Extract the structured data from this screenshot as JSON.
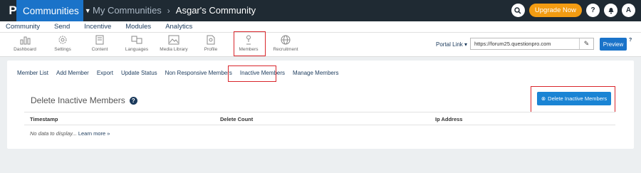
{
  "header": {
    "logo_letter": "P",
    "app_name": "Communities",
    "breadcrumb_root": "My Communities",
    "breadcrumb_current": "Asgar's Community",
    "upgrade_label": "Upgrade Now",
    "help_label": "?",
    "avatar_label": "A"
  },
  "menu": [
    "Community",
    "Send",
    "Incentive",
    "Modules",
    "Analytics"
  ],
  "toolbar": [
    {
      "label": "Dashboard",
      "icon": "chart-icon"
    },
    {
      "label": "Settings",
      "icon": "gear-icon"
    },
    {
      "label": "Content",
      "icon": "document-icon"
    },
    {
      "label": "Languages",
      "icon": "translate-icon"
    },
    {
      "label": "Media Library",
      "icon": "image-icon"
    },
    {
      "label": "Profile",
      "icon": "profile-icon"
    },
    {
      "label": "Members",
      "icon": "person-icon"
    },
    {
      "label": "Recruitment",
      "icon": "globe-icon"
    }
  ],
  "portal": {
    "link_label": "Portal Link",
    "url": "https://forum25.questionpro.com",
    "preview_label": "Preview"
  },
  "tabs": [
    "Member List",
    "Add Member",
    "Export",
    "Update Status",
    "Non Responsive Members",
    "Inactive Members",
    "Manage Members"
  ],
  "section": {
    "title": "Delete Inactive Members",
    "delete_button": "Delete Inactive Members"
  },
  "table": {
    "columns": [
      "Timestamp",
      "Delete Count",
      "Ip Address"
    ],
    "empty_text": "No data to display...",
    "learn_more": "Learn more »"
  },
  "colors": {
    "topbar": "#1f2a33",
    "accent": "#1a73c9",
    "upgrade": "#f39c12",
    "highlight": "#d9262c"
  }
}
